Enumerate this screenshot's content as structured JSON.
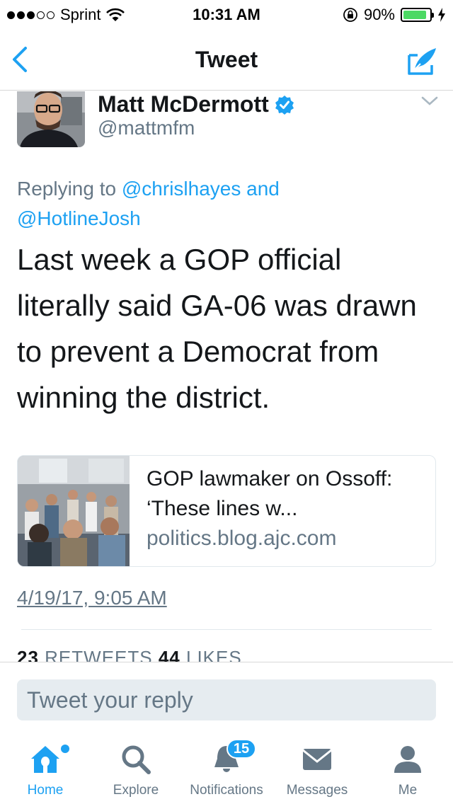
{
  "status_bar": {
    "carrier": "Sprint",
    "time": "10:31 AM",
    "battery": "90%",
    "battery_level": 0.9,
    "signal_bars_filled": 3,
    "signal_bars_total": 5
  },
  "nav": {
    "title": "Tweet",
    "back_icon": "chevron-left-icon",
    "compose_icon": "compose-tweet-icon"
  },
  "tweet": {
    "author_name": "Matt McDermott",
    "author_handle": "@mattmfm",
    "verified": true,
    "replying_prefix": "Replying to ",
    "reply_to_1": "@chrislhayes",
    "reply_conjunction": " and ",
    "reply_to_2": "@HotlineJosh",
    "text": "Last week a GOP official literally said GA-06 was drawn to prevent a Democrat from winning the district.",
    "card": {
      "title": "GOP lawmaker on Ossoff: ‘These lines w...",
      "domain": "politics.blog.ajc.com"
    },
    "timestamp": "4/19/17, 9:05 AM",
    "retweets_count": "23",
    "retweets_label": "RETWEETS",
    "likes_count": "44",
    "likes_label": "LIKES"
  },
  "reply": {
    "placeholder": "Tweet your reply"
  },
  "tabs": [
    {
      "label": "Home",
      "icon": "home-icon",
      "active": true
    },
    {
      "label": "Explore",
      "icon": "search-icon",
      "active": false
    },
    {
      "label": "Notifications",
      "icon": "bell-icon",
      "active": false,
      "badge": "15"
    },
    {
      "label": "Messages",
      "icon": "envelope-icon",
      "active": false
    },
    {
      "label": "Me",
      "icon": "person-icon",
      "active": false
    }
  ],
  "colors": {
    "accent": "#1da1f2",
    "muted": "#657786",
    "text": "#14171a"
  }
}
